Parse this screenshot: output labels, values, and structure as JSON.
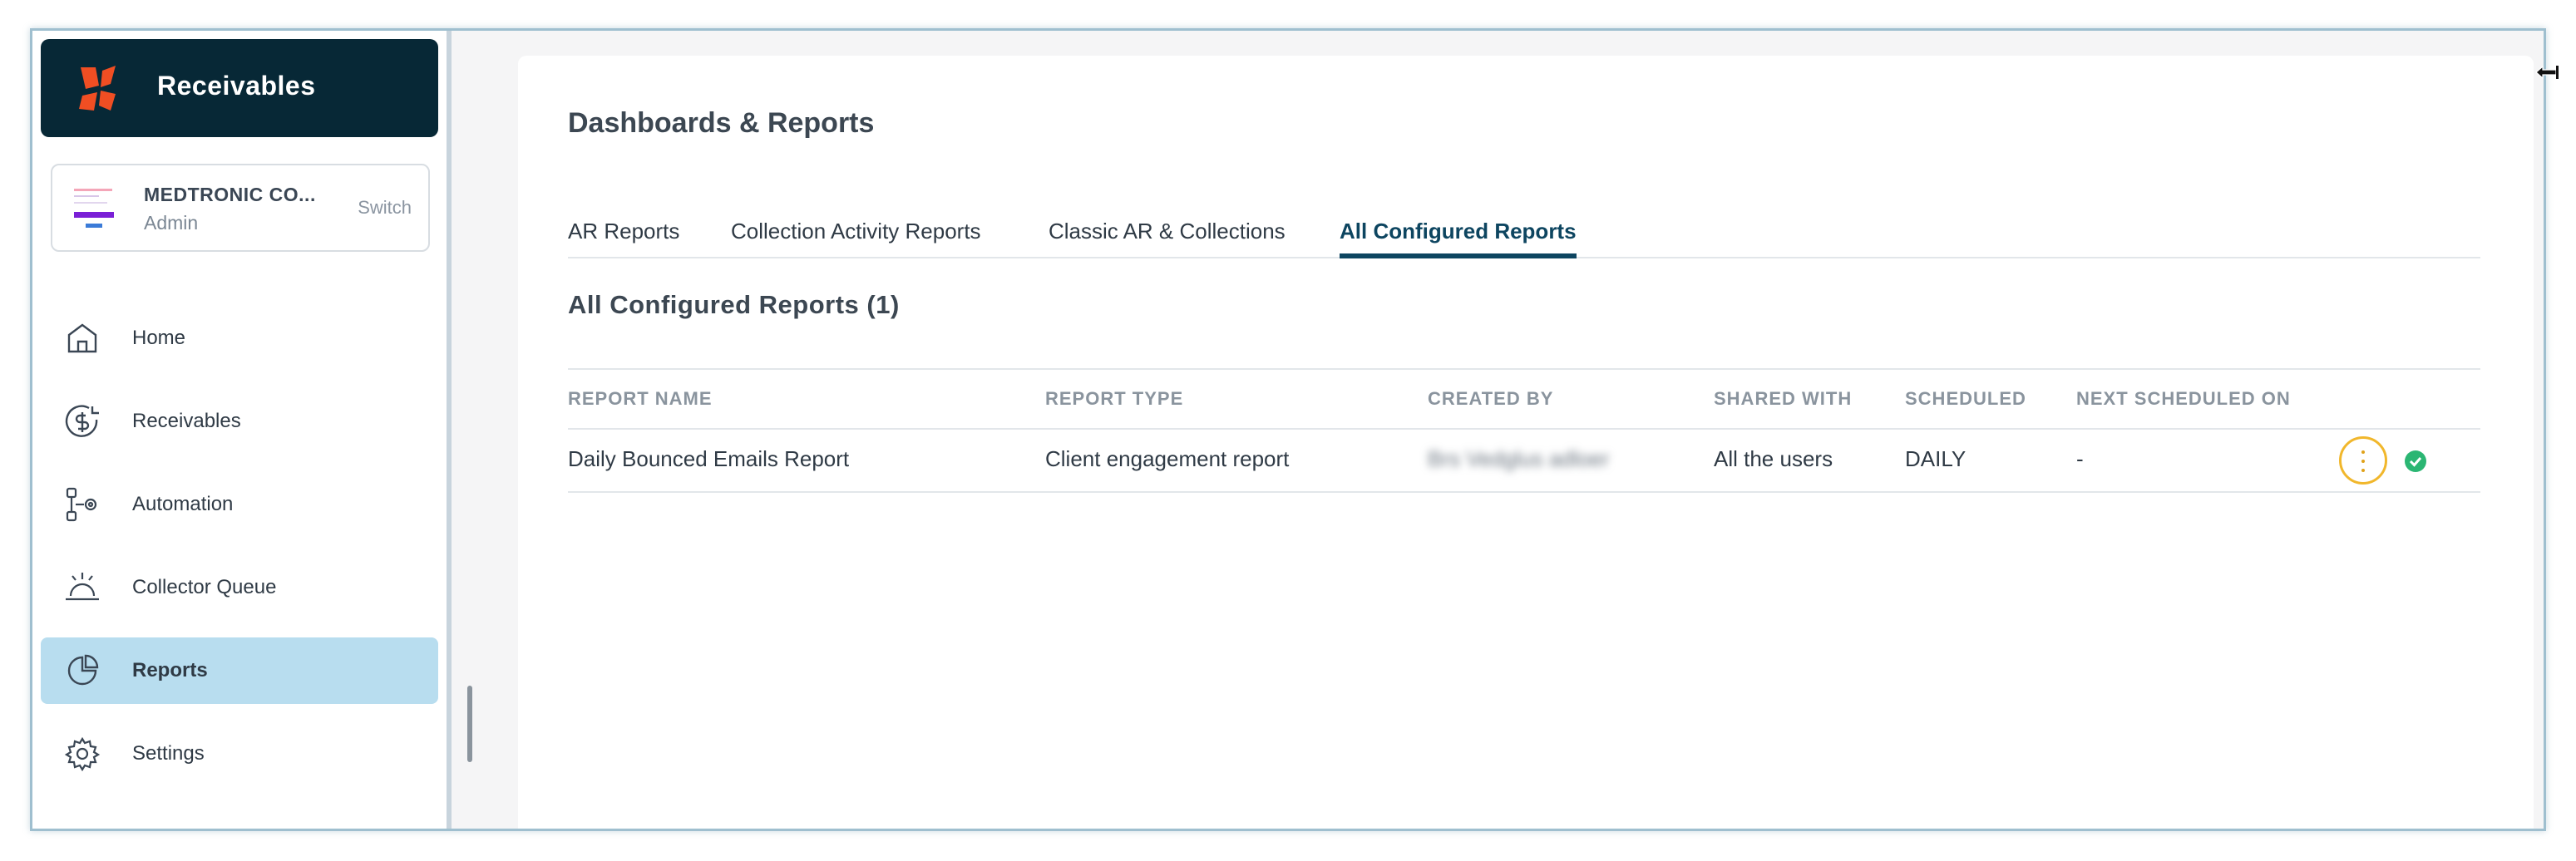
{
  "sidebar": {
    "brand_title": "Receivables",
    "org": {
      "name": "MEDTRONIC CO...",
      "role": "Admin",
      "switch_label": "Switch"
    },
    "items": [
      {
        "label": "Home",
        "icon": "home-icon"
      },
      {
        "label": "Receivables",
        "icon": "dollar-refresh-icon"
      },
      {
        "label": "Automation",
        "icon": "automation-icon"
      },
      {
        "label": "Collector Queue",
        "icon": "service-bell-icon"
      },
      {
        "label": "Reports",
        "icon": "pie-chart-icon",
        "active": true
      },
      {
        "label": "Settings",
        "icon": "gear-icon"
      }
    ]
  },
  "main": {
    "page_title": "Dashboards & Reports",
    "tabs": [
      {
        "label": "AR Reports"
      },
      {
        "label": "Collection Activity Reports"
      },
      {
        "label": "Classic AR & Collections"
      },
      {
        "label": "All Configured Reports",
        "active": true
      }
    ],
    "section_title": "All Configured Reports (1)",
    "table": {
      "headers": [
        "REPORT NAME",
        "REPORT TYPE",
        "CREATED BY",
        "SHARED WITH",
        "SCHEDULED",
        "NEXT SCHEDULED ON"
      ],
      "rows": [
        {
          "report_name": "Daily Bounced Emails Report",
          "report_type": "Client engagement report",
          "created_by": "Brs Vedglus adloer",
          "shared_with": "All the users",
          "scheduled": "DAILY",
          "next_scheduled_on": "-"
        }
      ]
    }
  },
  "colors": {
    "brand_bg": "#072836",
    "brand_accent": "#f04e23",
    "active_nav": "#b8ddef",
    "active_tab": "#0d4560",
    "kebab_border": "#f1b72c",
    "status_ok": "#2bb673"
  }
}
